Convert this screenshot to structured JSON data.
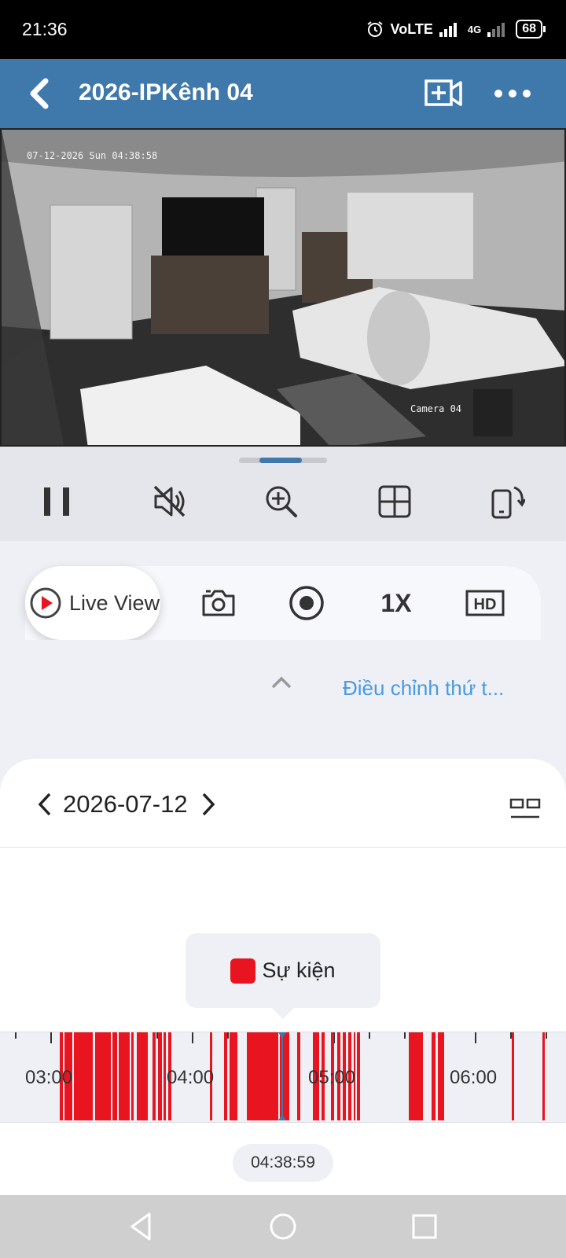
{
  "status_bar": {
    "time": "21:36",
    "network": "VoLTE",
    "data": "4G",
    "battery": "68"
  },
  "header": {
    "title": "2026-IPKênh 04",
    "back_icon": "back-arrow-icon",
    "add_icon": "video-add-icon",
    "more_icon": "more-dots-icon"
  },
  "video": {
    "timestamp": "07-12-2026 Sun 04:38:58",
    "camera_label": "Camera 04"
  },
  "controls": {
    "icons": [
      "pause-icon",
      "mute-icon",
      "zoom-in-icon",
      "grid-icon",
      "rotate-screen-icon"
    ]
  },
  "actions": {
    "live_view_label": "Live View",
    "speed_label": "1X",
    "quality_label": "HD",
    "adjust_label": "Điều chỉnh thứ t...",
    "accent_color": "#e8141f",
    "link_color": "#4a9ae0"
  },
  "playback": {
    "date": "2026-07-12",
    "event_label": "Sự kiện",
    "current_time": "04:38:59",
    "event_color": "#e8141f",
    "timeline_labels": [
      "03:00",
      "04:00",
      "05:00",
      "06:00"
    ]
  },
  "nav": {
    "icons": [
      "back-triangle-icon",
      "home-circle-icon",
      "recents-square-icon"
    ]
  }
}
